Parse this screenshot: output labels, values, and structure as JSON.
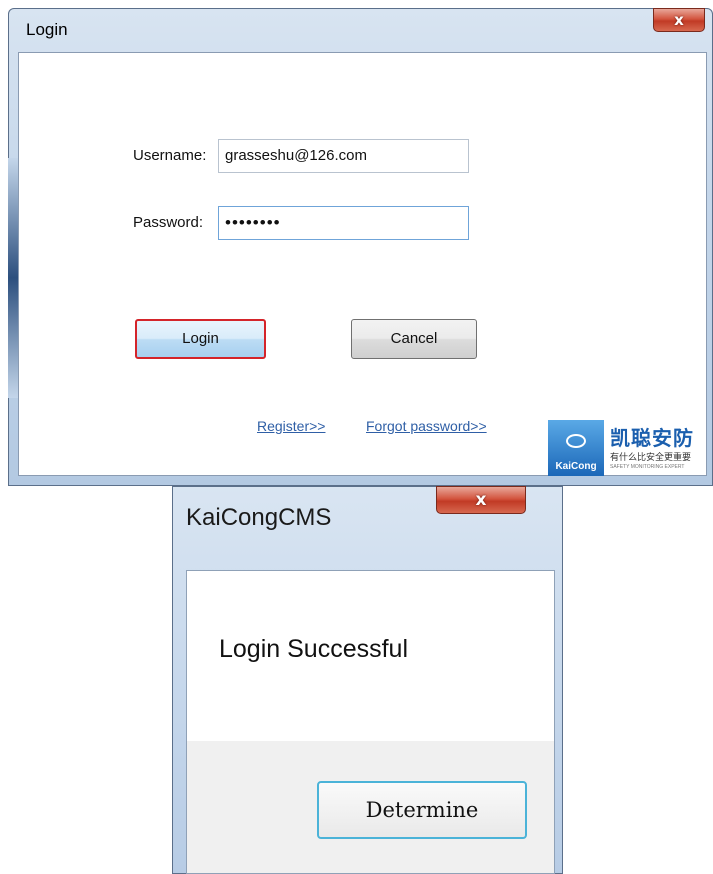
{
  "login_dialog": {
    "title": "Login",
    "close_glyph": "x",
    "username_label": "Username:",
    "username_value": "grasseshu@126.com",
    "password_label": "Password:",
    "password_value": "••••••••",
    "login_button": "Login",
    "cancel_button": "Cancel",
    "register_link": "Register>>",
    "forgot_link": "Forgot password>>",
    "logo": {
      "brand_en": "KaiCong",
      "brand_cn": "凯聪安防",
      "slogan": "有什么比安全更重要",
      "subline": "SAFETY MONITORING EXPERT"
    }
  },
  "message_dialog": {
    "title": "KaiCongCMS",
    "close_glyph": "x",
    "message": "Login Successful",
    "button": "Determine"
  },
  "colors": {
    "default_button_border": "#d4242a",
    "link": "#2f5fa6",
    "close_button": "#c13a25",
    "determine_border": "#4bb3d8"
  }
}
